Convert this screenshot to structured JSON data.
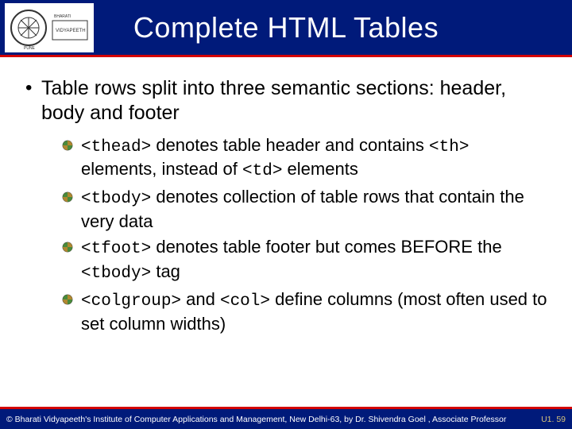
{
  "header": {
    "title": "Complete HTML Tables",
    "logo_alt": "Bharati Vidyapeeth emblem"
  },
  "content": {
    "main_bullet": "Table rows split into three semantic sections: header, body and footer",
    "sub_bullets": [
      {
        "code1": "<thead>",
        "text_a": " denotes table header and contains ",
        "code2": "<th>",
        "text_b": " elements, instead of ",
        "code3": "<td>",
        "text_c": " elements"
      },
      {
        "code1": "<tbody>",
        "text_a": " denotes collection of table rows that contain the very data"
      },
      {
        "code1": "<tfoot>",
        "text_a": " denotes table footer but comes BEFORE the ",
        "code2": "<tbody>",
        "text_b": " tag"
      },
      {
        "code1": "<colgroup>",
        "text_a": " and ",
        "code2": "<col>",
        "text_b": " define columns (most often used to set column widths)"
      }
    ]
  },
  "footer": {
    "copyright": "© Bharati Vidyapeeth's Institute of Computer Applications and Management, New Delhi-63, by Dr. Shivendra Goel , Associate Professor",
    "page_ref": "U1. 59"
  },
  "colors": {
    "band_blue": "#001a7a",
    "accent_red": "#d40000",
    "footer_gold": "#d4c27a"
  }
}
